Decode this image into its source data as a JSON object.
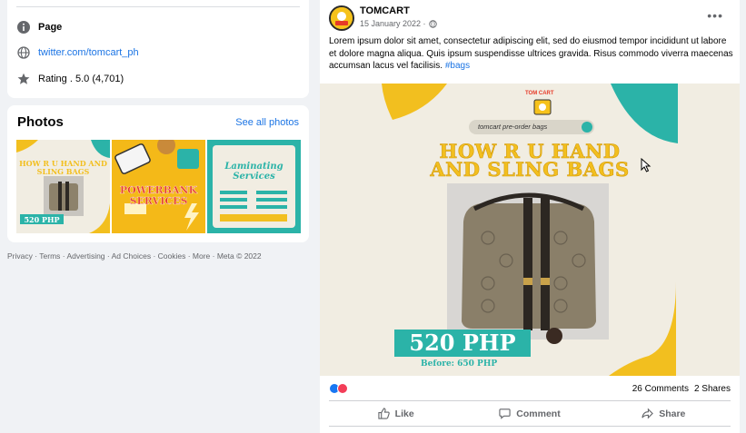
{
  "about": {
    "type_label": "Page",
    "link": "twitter.com/tomcart_ph",
    "rating": "Rating . 5.0 (4,701)"
  },
  "photos": {
    "title": "Photos",
    "see_all": "See all photos",
    "thumb1": {
      "title": "HOW R U HAND AND SLING BAGS",
      "price": "520 PHP"
    },
    "thumb2": {
      "title": "POWERBANK SERVICES"
    },
    "thumb3": {
      "title": "Laminating Services"
    }
  },
  "footer": "Privacy · Terms · Advertising · Ad Choices · Cookies · More · Meta © 2022",
  "post": {
    "author": "TOMCART",
    "date": "15 January 2022 ·",
    "text": "Lorem ipsum dolor sit amet, consectetur adipiscing elit, sed do eiusmod tempor incididunt ut labore et dolore magna aliqua. Quis ipsum suspendisse ultrices gravida. Risus commodo viverra maecenas accumsan lacus vel facilisis.",
    "hashtag": "#bags",
    "image": {
      "logo": "TOM CART",
      "search": "tomcart pre-order bags",
      "headline1": "HOW R U HAND",
      "headline2": "AND SLING BAGS",
      "price": "520 PHP",
      "before": "Before: 650 PHP"
    },
    "comments": "26 Comments",
    "shares": "2 Shares",
    "actions": {
      "like": "Like",
      "comment": "Comment",
      "share": "Share"
    }
  },
  "colors": {
    "accent": "#1b74e4",
    "teal": "#2bb3a8",
    "yellow": "#f2bf1f"
  }
}
